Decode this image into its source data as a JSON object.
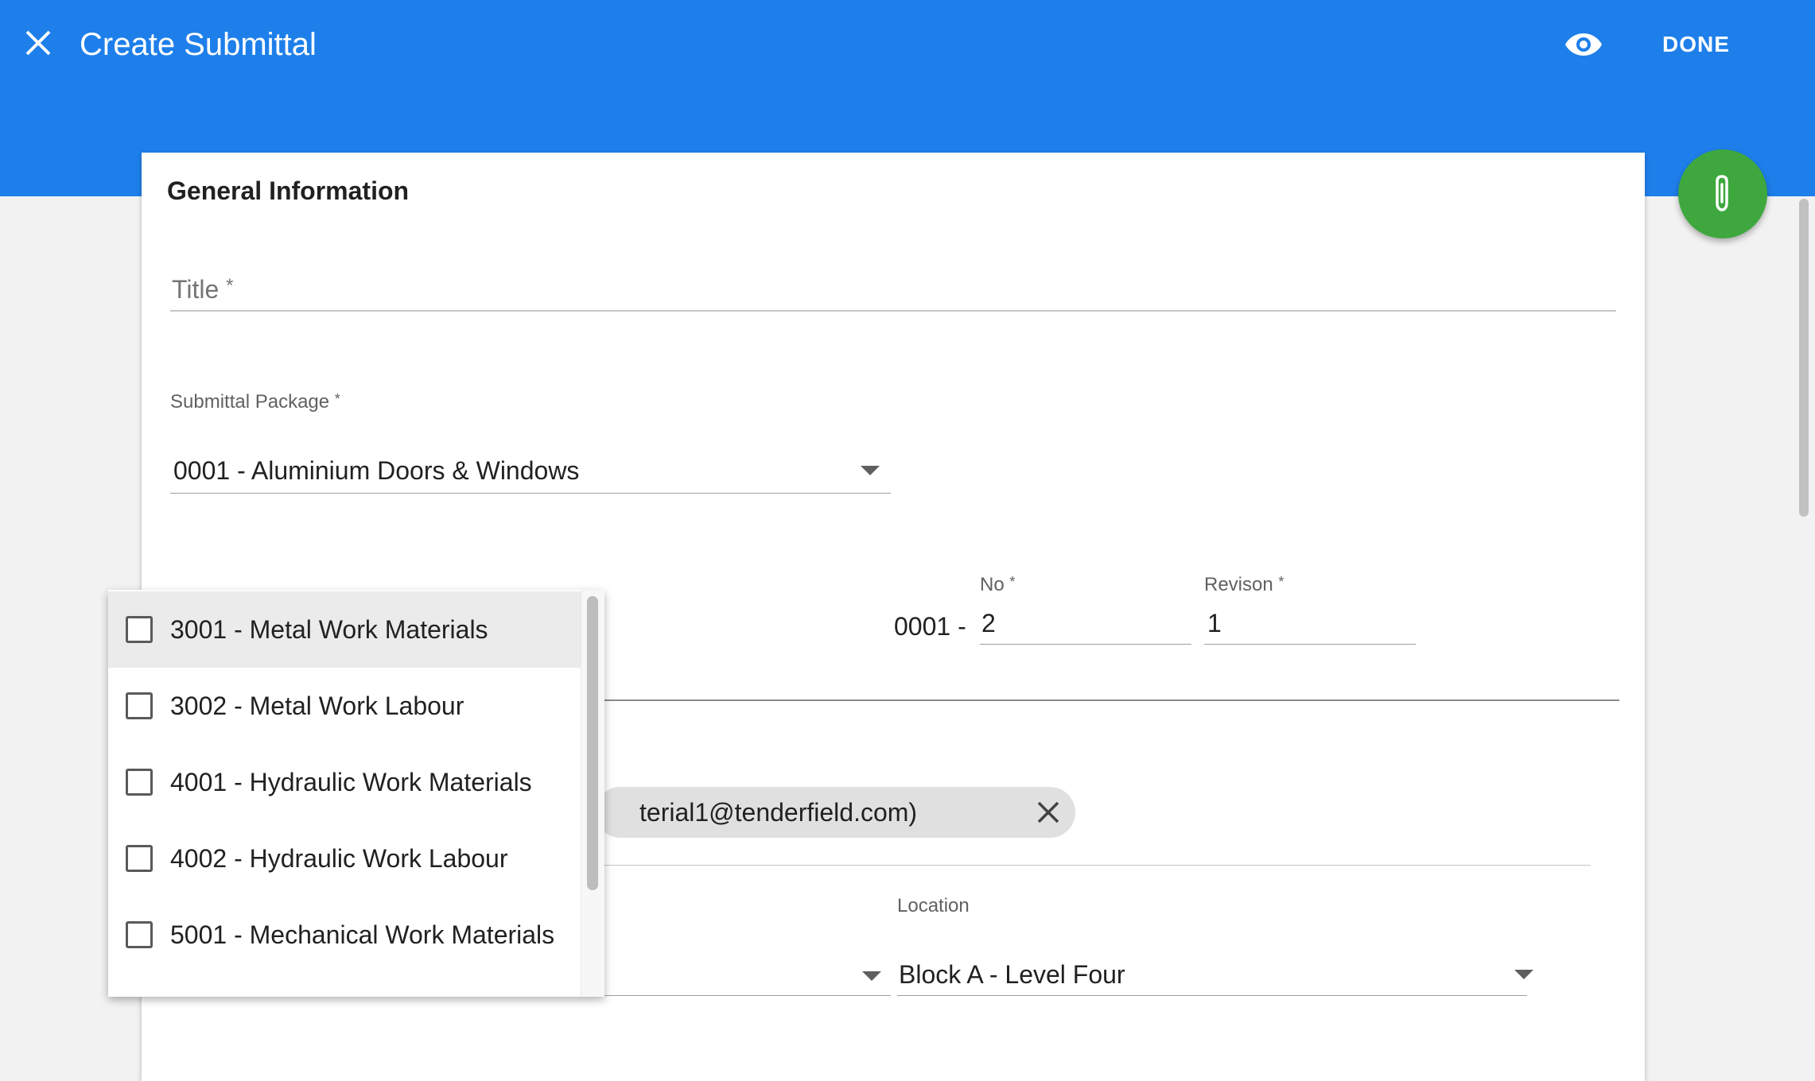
{
  "appbar": {
    "title": "Create Submittal",
    "done_label": "DONE",
    "close_icon": "close-icon",
    "preview_icon": "eye-icon",
    "color": "#1e7fea"
  },
  "fab": {
    "icon": "paperclip-icon",
    "color": "#3ea83e"
  },
  "form": {
    "section_title": "General Information",
    "title_field": {
      "label": "Title",
      "required_mark": "*",
      "value": ""
    },
    "package_field": {
      "label": "Submittal Package",
      "required_mark": "*",
      "value": "0001 - Aluminium Doors & Windows"
    },
    "number": {
      "prefix": "0001 -",
      "no_label": "No",
      "no_value": "2",
      "revision_label": "Revison",
      "revision_value": "1",
      "required_mark": "*"
    },
    "contact_chip": {
      "text": "terial1@tenderfield.com)"
    },
    "location_field": {
      "label": "Location",
      "value": "Block A - Level Four"
    }
  },
  "dropdown": {
    "items": [
      {
        "label": "3001 - Metal Work Materials",
        "checked": false
      },
      {
        "label": "3002 - Metal Work Labour",
        "checked": false
      },
      {
        "label": "4001 - Hydraulic Work Materials",
        "checked": false
      },
      {
        "label": "4002 - Hydraulic Work Labour",
        "checked": false
      },
      {
        "label": "5001 - Mechanical Work Materials",
        "checked": false
      }
    ]
  }
}
